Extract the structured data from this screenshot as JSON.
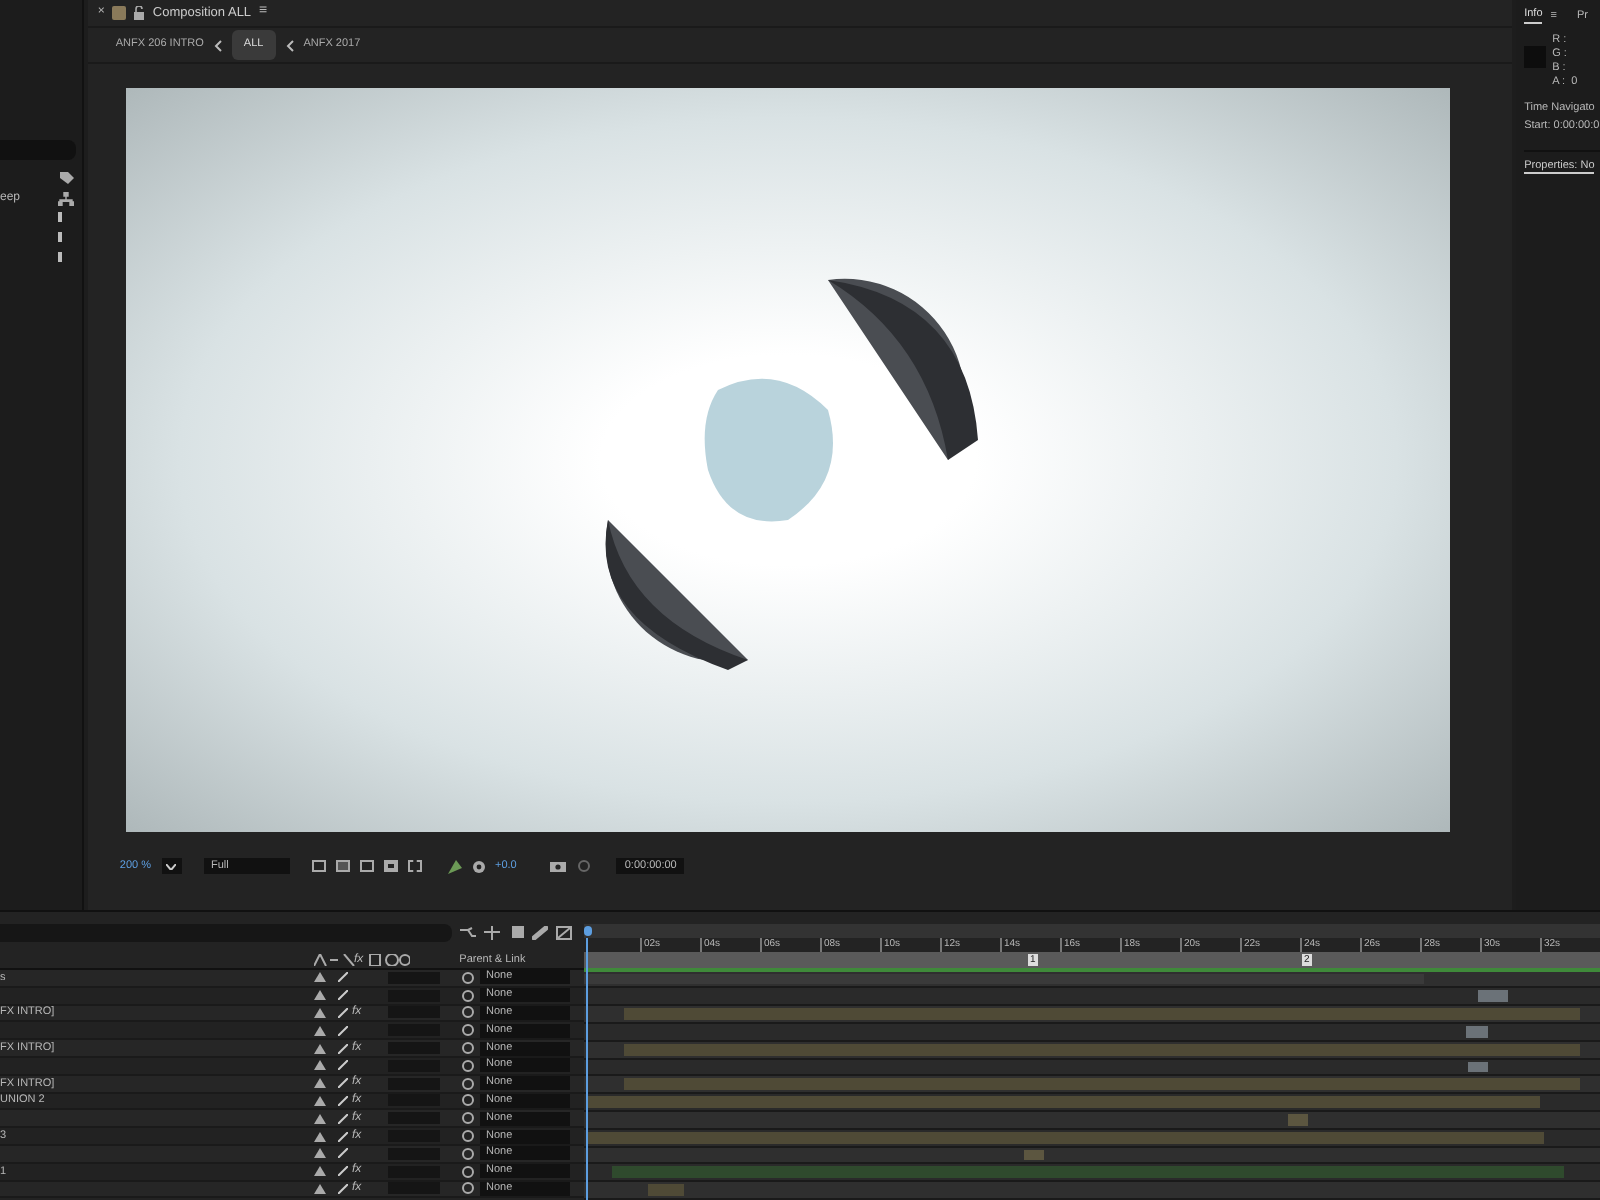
{
  "project_panel": {
    "partial_label": "eep"
  },
  "composition_tab": {
    "close": "×",
    "title": "Composition ALL",
    "menu": "≡"
  },
  "breadcrumbs": [
    {
      "label": "ANFX 206 INTRO",
      "selected": false
    },
    {
      "label": "ALL",
      "selected": true
    },
    {
      "label": "ANFX 2017",
      "selected": false
    }
  ],
  "viewer_toolbar": {
    "zoom": "200 %",
    "resolution": "Full",
    "exposure": "+0.0",
    "timecode": "0:00:00:00"
  },
  "info_panel": {
    "tab": "Info",
    "menu": "≡",
    "next_tab": "Pr",
    "channels": [
      {
        "label": "R :"
      },
      {
        "label": "G :"
      },
      {
        "label": "B :"
      },
      {
        "label": "A :",
        "value": "0"
      }
    ],
    "time_navigator": "Time Navigato",
    "start": "Start: 0:00:00:0",
    "properties": "Properties: No"
  },
  "timeline": {
    "fx_header": "fx",
    "cache_bar": {
      "level": 1
    },
    "parent_header": "Parent & Link",
    "ruler": [
      "02s",
      "04s",
      "06s",
      "08s",
      "10s",
      "12s",
      "14s",
      "16s",
      "18s",
      "20s",
      "22s",
      "24s",
      "26s",
      "28s",
      "30s",
      "32s"
    ],
    "markers": [
      "1",
      "2"
    ],
    "layers": [
      {
        "name": "s",
        "parent": "None"
      },
      {
        "parent": "None"
      },
      {
        "name": "FX INTRO]",
        "effects": "fx",
        "parent": "None"
      },
      {
        "parent": "None"
      },
      {
        "name": "FX INTRO]",
        "effects": "fx",
        "parent": "None"
      },
      {
        "parent": "None"
      },
      {
        "name": "FX INTRO]",
        "effects": "fx",
        "parent": "None"
      },
      {
        "name": "UNION 2",
        "effects": "fx",
        "parent": "None"
      },
      {
        "effects": "fx",
        "parent": "None"
      },
      {
        "name": "3",
        "effects": "fx",
        "parent": "None"
      },
      {
        "parent": "None"
      },
      {
        "name": "1",
        "effects": "fx",
        "parent": "None"
      },
      {
        "effects": "fx",
        "parent": "None"
      }
    ]
  }
}
